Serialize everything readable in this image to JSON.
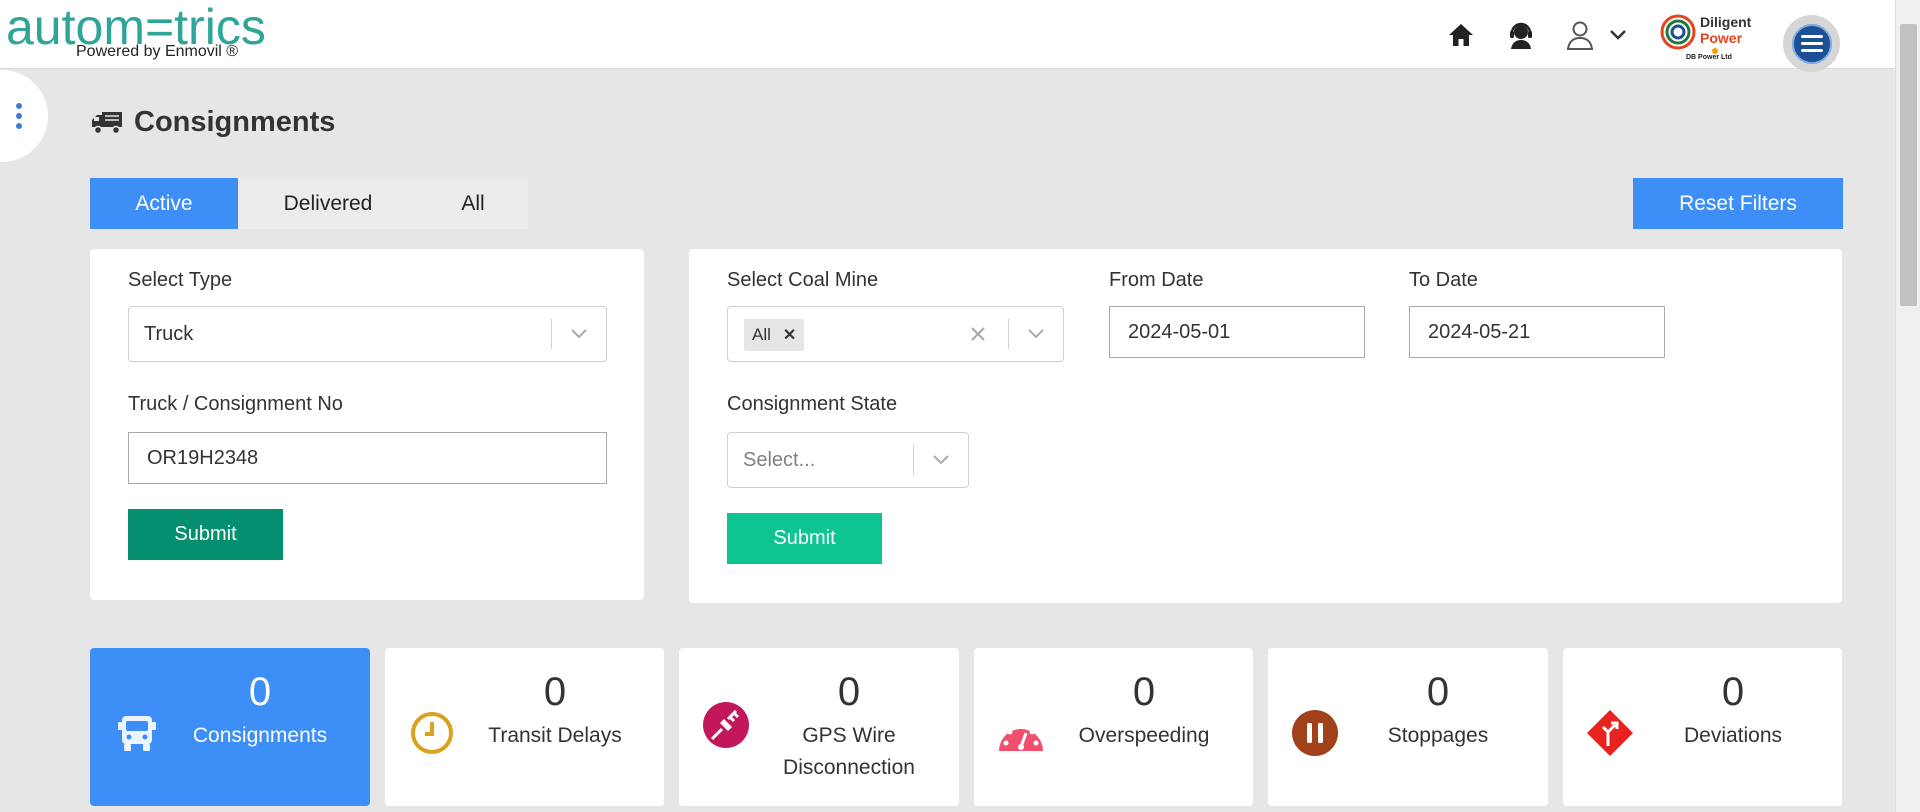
{
  "header": {
    "logo_main": "autom=trics",
    "logo_sub": "Powered by Enmovil ®",
    "brand_line1": "Diligent",
    "brand_line2": "Power",
    "brand_line3": "DB Power Ltd"
  },
  "page": {
    "title": "Consignments"
  },
  "tabs": [
    {
      "label": "Active",
      "active": true
    },
    {
      "label": "Delivered",
      "active": false
    },
    {
      "label": "All",
      "active": false
    }
  ],
  "reset_filters_label": "Reset Filters",
  "left_panel": {
    "type_label": "Select Type",
    "type_value": "Truck",
    "search_label": "Truck / Consignment No",
    "search_value": "OR19H2348",
    "submit_label": "Submit"
  },
  "right_panel": {
    "coal_mine_label": "Select Coal Mine",
    "coal_mine_chip": "All",
    "from_label": "From Date",
    "from_value": "2024-05-01",
    "to_label": "To Date",
    "to_value": "2024-05-21",
    "state_label": "Consignment State",
    "state_placeholder": "Select...",
    "submit_label": "Submit"
  },
  "stats": [
    {
      "count": "0",
      "label": "Consignments",
      "icon": "truck-icon"
    },
    {
      "count": "0",
      "label": "Transit Delays",
      "icon": "clock-icon"
    },
    {
      "count": "0",
      "label": "GPS Wire Disconnection",
      "icon": "unplug-icon"
    },
    {
      "count": "0",
      "label": "Overspeeding",
      "icon": "speedometer-icon"
    },
    {
      "count": "0",
      "label": "Stoppages",
      "icon": "pause-icon"
    },
    {
      "count": "0",
      "label": "Deviations",
      "icon": "route-deviation-icon"
    }
  ],
  "colors": {
    "accent": "#3d8ef7",
    "submit_dark": "#04906e",
    "submit_light": "#0ec592",
    "logo": "#2fa59a"
  }
}
